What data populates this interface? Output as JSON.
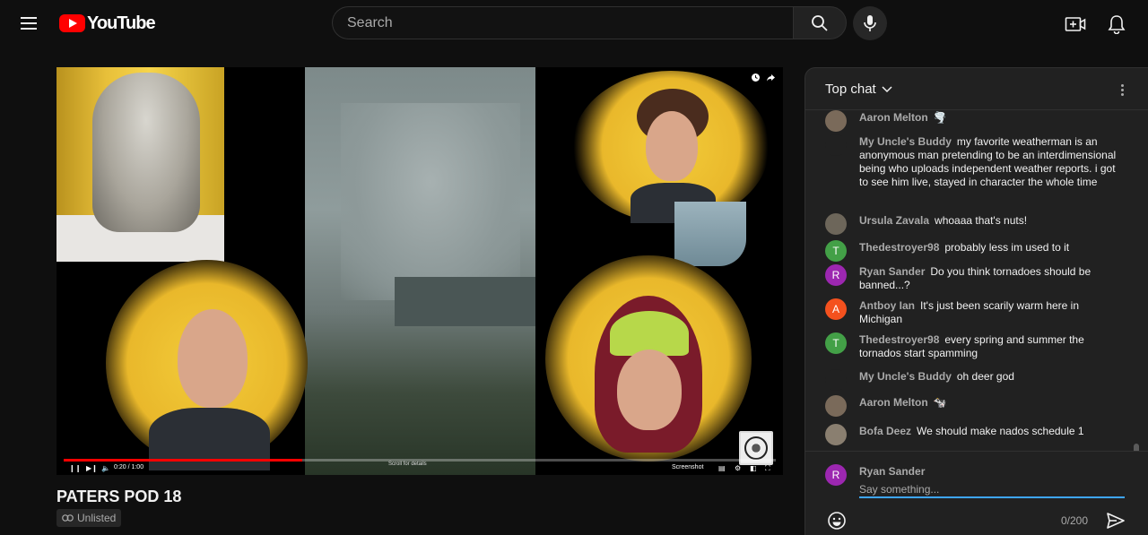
{
  "header": {
    "logo_text": "YouTube",
    "search_placeholder": "Search"
  },
  "video": {
    "time": "0:20 / 1:00",
    "progress": 0.335,
    "scroll_hint": "Scroll for details",
    "screenshot_label": "Screenshot"
  },
  "title": "PATERS POD 18",
  "visibility": "Unlisted",
  "chat": {
    "header": "Top chat",
    "messages": [
      {
        "author": "Aaron Melton",
        "text": "🌪️",
        "avatar": "",
        "avatar_color": "#7a6a5a"
      },
      {
        "author": "My Uncle's Buddy",
        "text": "my favorite weatherman is an anonymous man pretending to be an interdimensional being who uploads independent weather reports. i got to see him live, stayed in character the whole time",
        "avatar": "",
        "avatar_color": "#212121"
      },
      {
        "author": "Ursula Zavala",
        "text": "whoaaa that's nuts!",
        "avatar": "",
        "avatar_color": "#6d665a"
      },
      {
        "author": "Thedestroyer98",
        "text": "probably less im used to it",
        "avatar": "T",
        "avatar_color": "#43a047"
      },
      {
        "author": "Ryan Sander",
        "text": "Do you think tornadoes should be banned...?",
        "avatar": "R",
        "avatar_color": "#9c27b0"
      },
      {
        "author": "Antboy Ian",
        "text": "It's just been scarily warm here in Michigan",
        "avatar": "A",
        "avatar_color": "#f4511e"
      },
      {
        "author": "Thedestroyer98",
        "text": "every spring and summer the tornados start spamming",
        "avatar": "T",
        "avatar_color": "#43a047"
      },
      {
        "author": "My Uncle's Buddy",
        "text": "oh deer god",
        "avatar": "",
        "avatar_color": "#212121"
      },
      {
        "author": "Aaron Melton",
        "text": "🐄",
        "avatar": "",
        "avatar_color": "#7a6a5a"
      },
      {
        "author": "Bofa Deez",
        "text": "We should make nados schedule 1",
        "avatar": "",
        "avatar_color": "#8a7f70"
      }
    ],
    "composer": {
      "avatar": "R",
      "name": "Ryan Sander",
      "placeholder": "Say something...",
      "count": "0/200"
    }
  },
  "colors": {
    "background": "#0f0f0f",
    "chat_bg": "#212121",
    "accent_red": "#ff0000",
    "input_focus": "#3ea6ff"
  }
}
